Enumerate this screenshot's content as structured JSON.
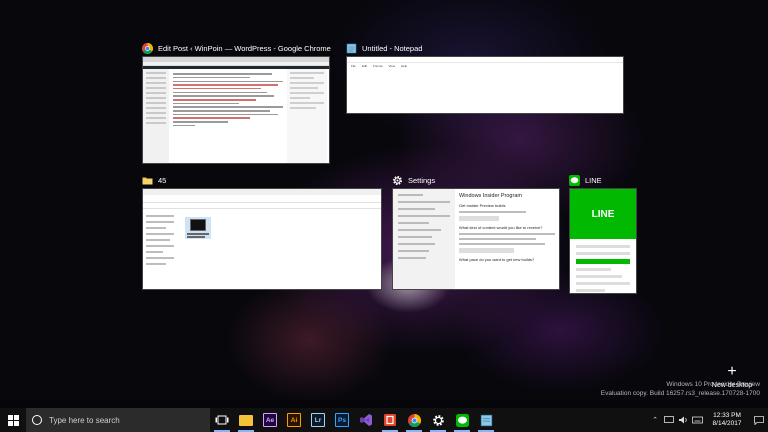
{
  "windows": [
    {
      "title": "Edit Post ‹ WinPoin — WordPress - Google Chrome",
      "icon": "chrome-icon"
    },
    {
      "title": "Untitled - Notepad",
      "icon": "notepad-icon"
    },
    {
      "title": "45",
      "icon": "folder-icon"
    },
    {
      "title": "Settings",
      "icon": "gear-icon"
    },
    {
      "title": "LINE",
      "icon": "line-icon"
    }
  ],
  "notepad": {
    "menu": [
      "File",
      "Edit",
      "Format",
      "View",
      "Help"
    ]
  },
  "explorer": {
    "file_label": "Microsoft Banned Membuka Sys"
  },
  "settings": {
    "heading": "Windows Insider Program",
    "sub1": "Get Insider Preview builds",
    "sub2": "What kind of content would you like to receive?",
    "sub3": "What pace do you want to get new builds?"
  },
  "line": {
    "logo": "LINE"
  },
  "new_desktop": {
    "label": "New desktop"
  },
  "watermark": {
    "line1": "Windows 10 Pro Insider Preview",
    "line2": "Evaluation copy. Build 16257.rs3_release.170728-1700"
  },
  "taskbar": {
    "search_placeholder": "Type here to search",
    "apps": [
      {
        "name": "File Explorer",
        "icon": "folder-icon",
        "color": "#f3c13a",
        "text": ""
      },
      {
        "name": "After Effects",
        "icon": "after-effects-icon",
        "color": "#1f0740",
        "text": "Ae"
      },
      {
        "name": "Illustrator",
        "icon": "illustrator-icon",
        "color": "#2b1400",
        "text": "Ai"
      },
      {
        "name": "Lightroom",
        "icon": "lightroom-icon",
        "color": "#0b1a2a",
        "text": "Lr"
      },
      {
        "name": "Photoshop",
        "icon": "photoshop-icon",
        "color": "#0c1b33",
        "text": "Ps"
      },
      {
        "name": "Visual Studio",
        "icon": "visual-studio-icon",
        "color": "#6e3fb3",
        "text": ""
      },
      {
        "name": "Office",
        "icon": "office-icon",
        "color": "#e0452a",
        "text": ""
      },
      {
        "name": "Google Chrome",
        "icon": "chrome-icon",
        "color": "#e5332a",
        "text": ""
      },
      {
        "name": "Settings",
        "icon": "gear-icon",
        "color": "#101010",
        "text": ""
      },
      {
        "name": "LINE",
        "icon": "line-icon",
        "color": "#00b900",
        "text": ""
      },
      {
        "name": "Notepad",
        "icon": "notepad-icon",
        "color": "#7fb8d9",
        "text": ""
      }
    ],
    "time": "12:33 PM",
    "date": "8/14/2017"
  }
}
